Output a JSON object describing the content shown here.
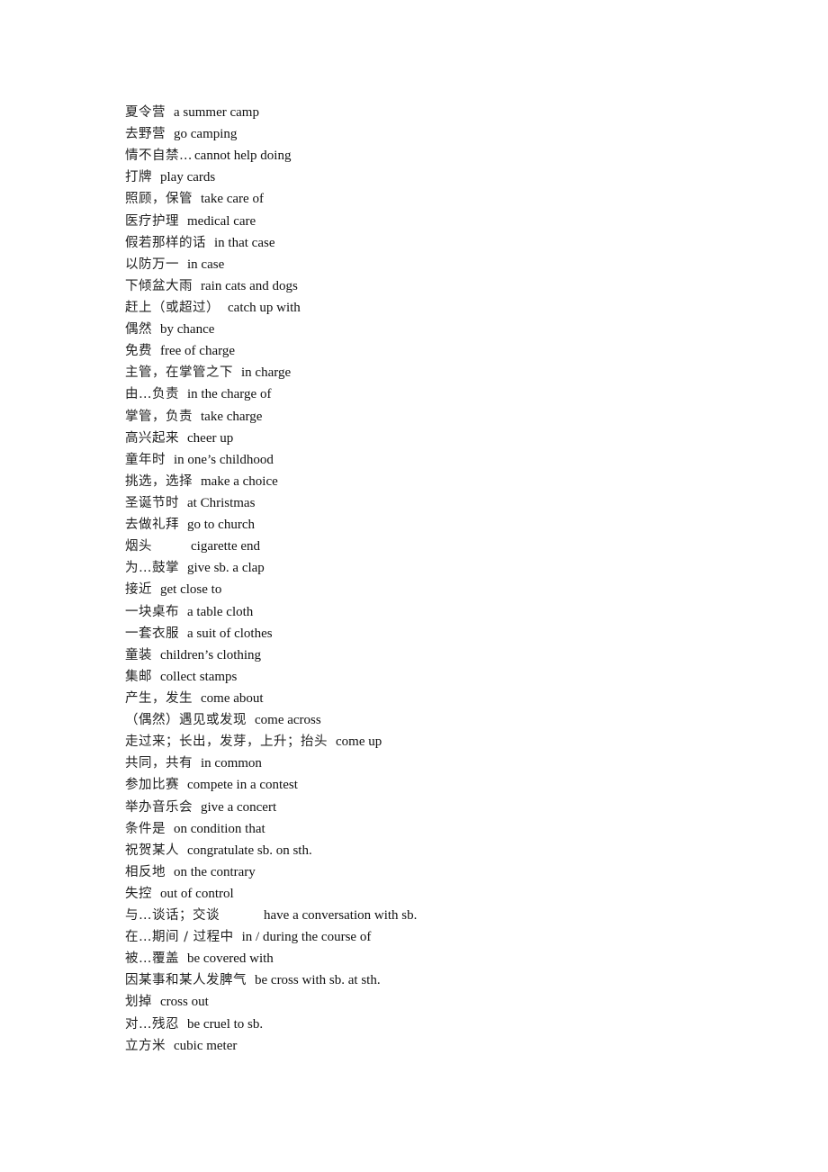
{
  "document": {
    "entries": [
      {
        "zh": "夏令营",
        "en": "a summer camp"
      },
      {
        "zh": "去野营",
        "en": "go camping"
      },
      {
        "zh": "情不自禁…",
        "en": "cannot help doing",
        "tight": true
      },
      {
        "zh": "打牌",
        "en": "play cards"
      },
      {
        "zh": "照顾，保管",
        "en": "take care of"
      },
      {
        "zh": "医疗护理",
        "en": "medical care"
      },
      {
        "zh": "假若那样的话",
        "en": "in that case"
      },
      {
        "zh": "以防万一",
        "en": "in case"
      },
      {
        "zh": "下倾盆大雨",
        "en": "rain cats and dogs"
      },
      {
        "zh": "赶上（或超过）",
        "en": "catch up with"
      },
      {
        "zh": "偶然",
        "en": "by chance"
      },
      {
        "zh": "免费",
        "en": "free of charge"
      },
      {
        "zh": "主管，在掌管之下",
        "en": "in charge"
      },
      {
        "zh": "由…负责",
        "en": "in the charge of"
      },
      {
        "zh": "掌管，负责",
        "en": "take charge"
      },
      {
        "zh": "高兴起来",
        "en": "cheer up"
      },
      {
        "zh": "童年时",
        "en": "in one’s childhood"
      },
      {
        "zh": "挑选，选择",
        "en": "make a choice"
      },
      {
        "zh": "圣诞节时",
        "en": "at Christmas"
      },
      {
        "zh": "去做礼拜",
        "en": "go to church"
      },
      {
        "zh": "烟头",
        "en": "cigarette end",
        "align_col": 73
      },
      {
        "zh": "为…鼓掌",
        "en": "give sb. a clap"
      },
      {
        "zh": "接近",
        "en": "get close to"
      },
      {
        "zh": "一块桌布",
        "en": "a table cloth"
      },
      {
        "zh": "一套衣服",
        "en": "a suit of clothes"
      },
      {
        "zh": "童装",
        "en": "children’s clothing"
      },
      {
        "zh": "集邮",
        "en": "collect stamps"
      },
      {
        "zh": "产生，发生",
        "en": "come about"
      },
      {
        "zh": "（偶然）遇见或发现",
        "en": "come across"
      },
      {
        "zh": "走过来；长出，发芽，上升；抬头",
        "en": "come up"
      },
      {
        "zh": "共同，共有",
        "en": "in common"
      },
      {
        "zh": "参加比赛",
        "en": "compete in a contest"
      },
      {
        "zh": "举办音乐会",
        "en": "give a concert"
      },
      {
        "zh": "条件是",
        "en": "on condition that"
      },
      {
        "zh": "祝贺某人",
        "en": "congratulate sb. on sth."
      },
      {
        "zh": "相反地",
        "en": "on the contrary"
      },
      {
        "zh": "失控",
        "en": "out of control"
      },
      {
        "zh": "与…谈话；交谈",
        "en": "have a conversation with sb.",
        "align_col": 154
      },
      {
        "zh": "在…期间 / 过程中",
        "en": "in / during the course of"
      },
      {
        "zh": "被…覆盖",
        "en": "be covered with"
      },
      {
        "zh": "因某事和某人发脾气",
        "en": "be cross with sb. at sth."
      },
      {
        "zh": "划掉",
        "en": "cross out"
      },
      {
        "zh": "对…残忍",
        "en": "be cruel to sb."
      },
      {
        "zh": "立方米",
        "en": "cubic meter"
      }
    ]
  }
}
